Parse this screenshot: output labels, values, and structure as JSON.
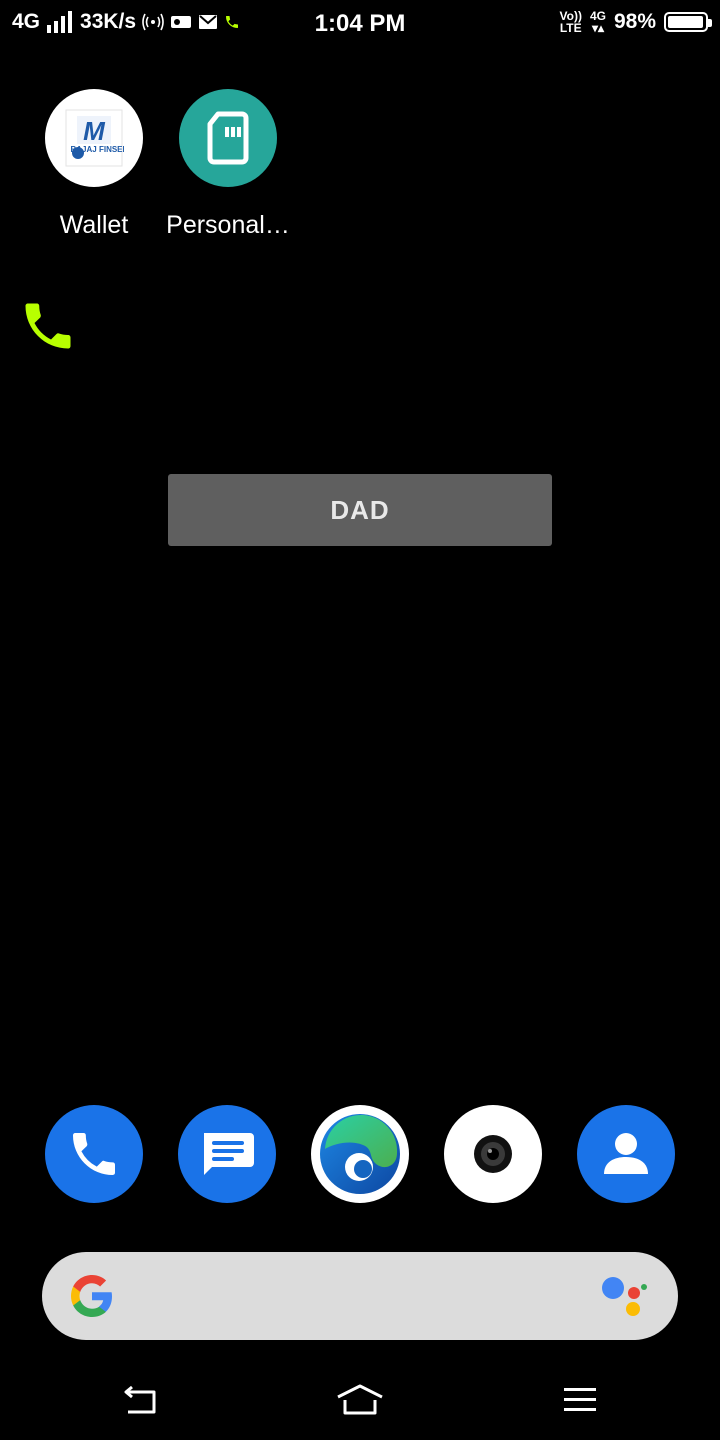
{
  "status_bar": {
    "network": "4G",
    "speed": "33K/s",
    "time": "1:04 PM",
    "volte_top": "Vo))",
    "volte_bottom": "LTE",
    "net_type": "4G",
    "battery": "98%",
    "battery_level": 0.98
  },
  "home_apps": [
    {
      "label": "Wallet",
      "icon": "bajaj-finserv-icon",
      "brand_text": "BAJAJ FINSERV"
    },
    {
      "label": "Personal…",
      "icon": "sim-card-icon"
    }
  ],
  "contact_widget": {
    "label": "DAD"
  },
  "dock": [
    {
      "icon": "phone-icon"
    },
    {
      "icon": "messages-icon"
    },
    {
      "icon": "edge-browser-icon"
    },
    {
      "icon": "camera-icon"
    },
    {
      "icon": "contacts-icon"
    }
  ],
  "search": {
    "logo": "google-g-icon",
    "assistant": "google-assistant-icon"
  },
  "colors": {
    "accent_blue": "#1a73e8",
    "teal": "#26a69a",
    "call_green": "#b8ff00",
    "widget_gray": "#5f5f5f"
  }
}
